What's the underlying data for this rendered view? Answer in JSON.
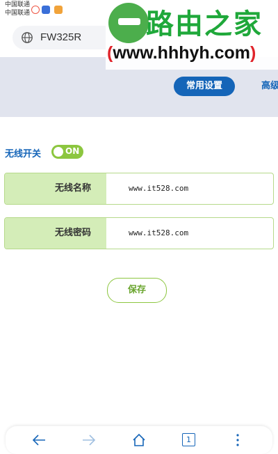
{
  "status_bar": {
    "carrier_1": "中国联通",
    "carrier_2": "中国联通"
  },
  "browser": {
    "url": "FW325R"
  },
  "watermark": {
    "title": "路由之家",
    "url": "(www.hhhyh.com)"
  },
  "tabs": {
    "common": "常用设置",
    "advanced": "高级"
  },
  "wireless": {
    "toggle_label": "无线开关",
    "toggle_state": "ON",
    "name_label": "无线名称",
    "name_value": "www.it528.com",
    "password_label": "无线密码",
    "password_value": "www.it528.com"
  },
  "actions": {
    "save_label": "保存"
  },
  "bottom_nav": {
    "tab_count": "1"
  },
  "colors": {
    "accent_blue": "#1565b8",
    "accent_green": "#8cc63f",
    "label_bg": "#d4edb8",
    "header_band": "#e1e4ee"
  },
  "icons": [
    "globe-icon",
    "back-icon",
    "forward-icon",
    "home-icon",
    "tabs-icon",
    "more-icon"
  ]
}
